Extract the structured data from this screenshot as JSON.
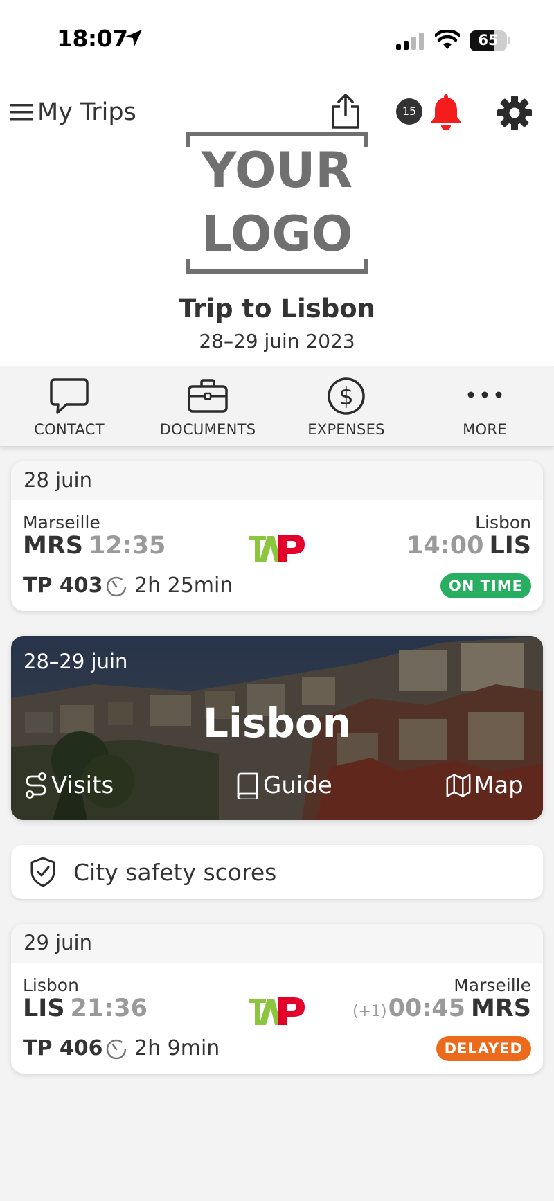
{
  "status_bar": {
    "time": "18:07",
    "battery": "65",
    "battery_level": 0.65
  },
  "header": {
    "menu_label": "My Trips",
    "notification_count": "15"
  },
  "logo": {
    "line1": "YOUR",
    "line2": "LOGO"
  },
  "trip": {
    "title": "Trip to Lisbon",
    "dates": "28–29 juin 2023"
  },
  "actions": [
    {
      "label": "CONTACT",
      "icon": "chat-bubble-icon"
    },
    {
      "label": "DOCUMENTS",
      "icon": "briefcase-icon"
    },
    {
      "label": "EXPENSES",
      "icon": "dollar-circle-icon"
    },
    {
      "label": "MORE",
      "icon": "more-dots-icon"
    }
  ],
  "flights": [
    {
      "date": "28 juin",
      "from_city": "Marseille",
      "from_code": "MRS",
      "dep_time": "12:35",
      "to_city": "Lisbon",
      "to_code": "LIS",
      "arr_time": "14:00",
      "day_offset": "",
      "number": "TP 403",
      "duration": "2h 25min",
      "status": "ON TIME",
      "status_color": "#27ae60"
    },
    {
      "date": "29 juin",
      "from_city": "Lisbon",
      "from_code": "LIS",
      "dep_time": "21:36",
      "to_city": "Marseille",
      "to_code": "MRS",
      "arr_time": "00:45",
      "day_offset": "(+1)",
      "number": "TP 406",
      "duration": "2h 9min",
      "status": "DELAYED",
      "status_color": "#ec6a1c"
    }
  ],
  "city": {
    "dates": "28–29 juin",
    "name": "Lisbon",
    "visits_label": "Visits",
    "guide_label": "Guide",
    "map_label": "Map"
  },
  "safety": {
    "label": "City safety scores"
  },
  "colors": {
    "bell": "#f41c1c",
    "tap_green": "#8cc63f",
    "tap_red": "#e4002b"
  }
}
